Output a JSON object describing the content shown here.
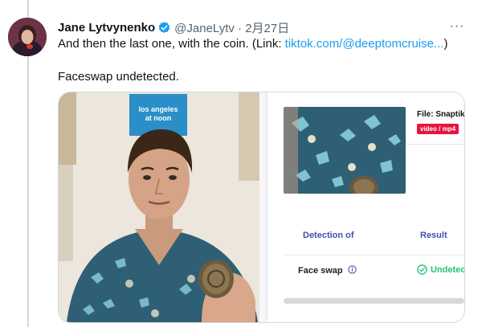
{
  "tweet": {
    "author_name": "Jane Lytvynenko",
    "handle_and_date": "@JaneLytv · 2月27日",
    "line1_text": "And then the last one, with the coin. (Link: ",
    "line1_link": "tiktok.com/@deeptomcruise...",
    "line1_close": ")",
    "line2_text": "Faceswap undetected.",
    "more_label": "···"
  },
  "video": {
    "poster_text_line1": "los angeles",
    "poster_text_line2": "at noon"
  },
  "detection": {
    "file_label": "File: Snaptik_(",
    "file_type_badge": "video / mp4",
    "col1_header": "Detection of",
    "col2_header": "Result",
    "row_label": "Face swap",
    "row_result": "Undetecte"
  },
  "colors": {
    "accent_link": "#1d9bf0",
    "badge_red": "#e4163d",
    "header_blue": "#3f51b5",
    "result_green": "#1fc27a"
  },
  "icons": [
    "verified-badge-icon",
    "more-options-icon",
    "info-icon",
    "check-circle-icon"
  ]
}
